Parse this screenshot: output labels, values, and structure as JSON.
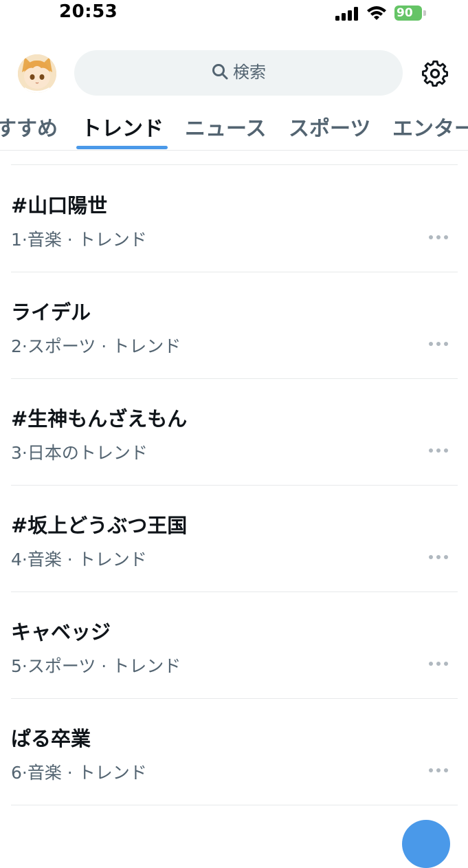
{
  "status_bar": {
    "time": "20:53",
    "battery": "90"
  },
  "header": {
    "search_placeholder": "検索"
  },
  "tabs": [
    {
      "label": "すすめ",
      "active": false
    },
    {
      "label": "トレンド",
      "active": true
    },
    {
      "label": "ニュース",
      "active": false
    },
    {
      "label": "スポーツ",
      "active": false
    },
    {
      "label": "エンター",
      "active": false
    }
  ],
  "trends": [
    {
      "title": "#山口陽世",
      "meta": "1·音楽 · トレンド"
    },
    {
      "title": "ライデル",
      "meta": "2·スポーツ · トレンド"
    },
    {
      "title": "#生神もんざえもん",
      "meta": "3·日本のトレンド"
    },
    {
      "title": "#坂上どうぶつ王国",
      "meta": "4·音楽 · トレンド"
    },
    {
      "title": "キャベッジ",
      "meta": "5·スポーツ · トレンド"
    },
    {
      "title": "ぱる卒業",
      "meta": "6·音楽 · トレンド"
    }
  ],
  "colors": {
    "accent": "#4a99e9",
    "battery": "#65c466",
    "secondary_text": "#536471"
  }
}
